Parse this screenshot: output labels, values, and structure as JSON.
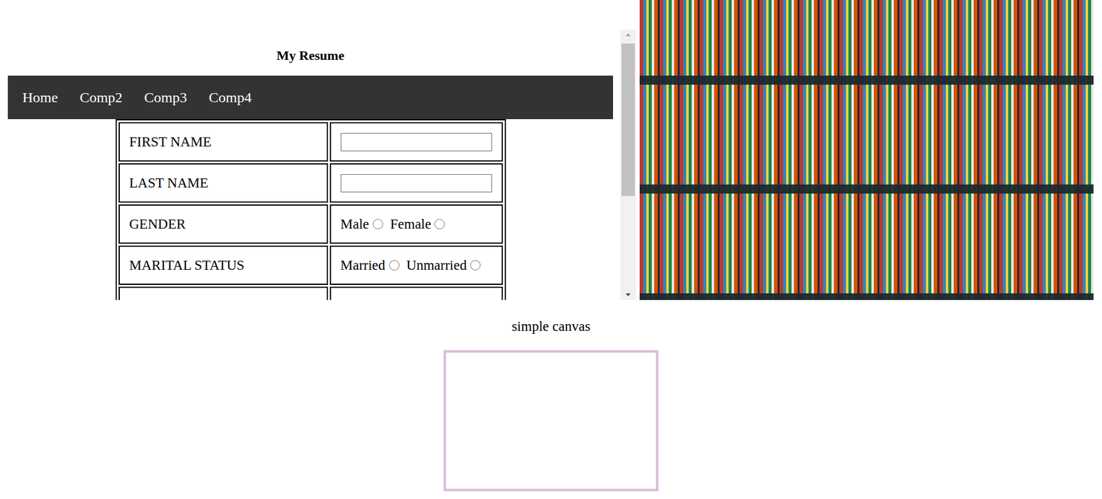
{
  "page": {
    "title": "My Resume"
  },
  "nav": [
    {
      "label": "Home"
    },
    {
      "label": "Comp2"
    },
    {
      "label": "Comp3"
    },
    {
      "label": "Comp4"
    }
  ],
  "form": {
    "rows": [
      {
        "label": "FIRST NAME",
        "kind": "text",
        "value": "",
        "options": []
      },
      {
        "label": "LAST NAME",
        "kind": "text",
        "value": "",
        "options": []
      },
      {
        "label": "GENDER",
        "kind": "radio",
        "value": "",
        "options": [
          {
            "label": "Male",
            "selected": false
          },
          {
            "label": "Female",
            "selected": false
          }
        ]
      },
      {
        "label": "MARITAL STATUS",
        "kind": "radio",
        "value": "",
        "options": [
          {
            "label": "Married",
            "selected": false
          },
          {
            "label": "Unmarried",
            "selected": false
          }
        ]
      },
      {
        "label": "",
        "kind": "blank",
        "value": "",
        "options": []
      }
    ]
  },
  "canvas": {
    "caption": "simple canvas"
  }
}
